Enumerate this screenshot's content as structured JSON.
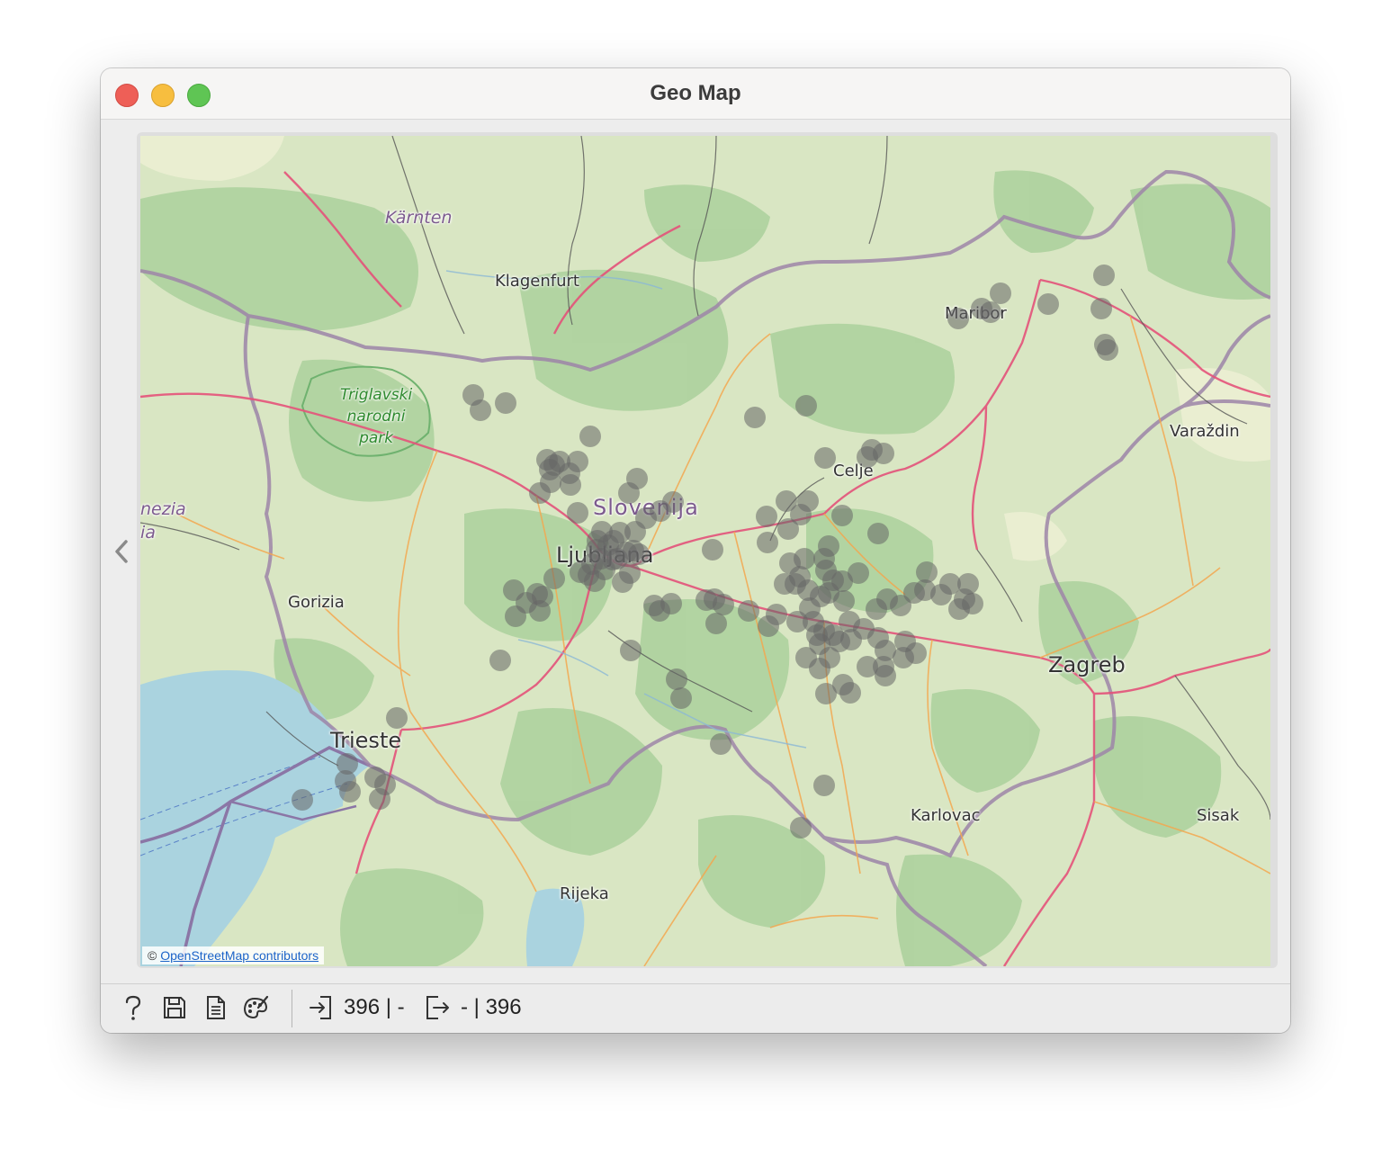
{
  "window": {
    "title": "Geo Map"
  },
  "map": {
    "labels": {
      "karnten": "Kärnten",
      "klagenfurt": "Klagenfurt",
      "maribor": "Maribor",
      "triglav_line1": "Triglavski",
      "triglav_line2": "narodni",
      "triglav_line3": "park",
      "varazdin": "Varaždin",
      "celje": "Celje",
      "slovenija": "Slovenija",
      "venezia_line1": "nezia",
      "venezia_line2": "ia",
      "ljubljana": "Ljubljana",
      "gorizia": "Gorizia",
      "zagreb": "Zagreb",
      "trieste": "Trieste",
      "karlovac": "Karlovac",
      "sisak": "Sisak",
      "rijeka": "Rijeka"
    },
    "attribution_prefix": "©",
    "attribution_link": "OpenStreetMap contributors",
    "point_color": "#666666"
  },
  "statusbar": {
    "input_summary": "396 | -",
    "output_summary": "- | 396"
  }
}
